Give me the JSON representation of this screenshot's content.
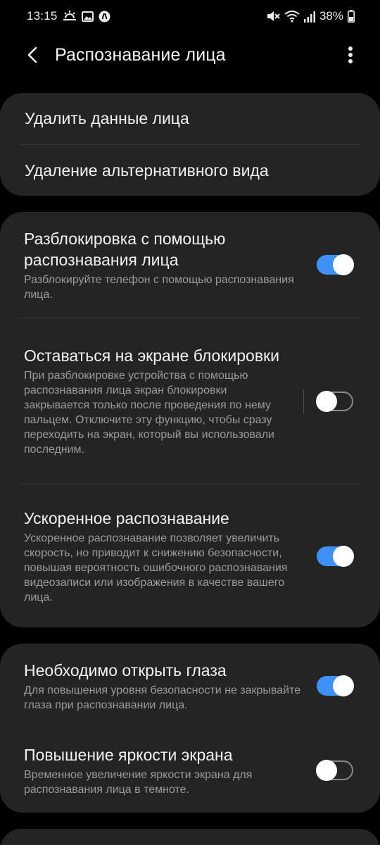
{
  "status_bar": {
    "time": "13:15",
    "left_icons": [
      "weather-icon",
      "image-icon",
      "app-notification-icon"
    ],
    "right_icons": [
      "mute-icon",
      "wifi-icon",
      "signal-icon",
      "battery-icon"
    ],
    "battery": "38%"
  },
  "app_bar": {
    "title": "Распознавание лица"
  },
  "card1": {
    "items": [
      {
        "label": "Удалить данные лица"
      },
      {
        "label": "Удаление альтернативного вида"
      }
    ]
  },
  "card2": {
    "items": [
      {
        "title": "Разблокировка с помощью распознавания лица",
        "subtitle": "Разблокируйте телефон с помощью распознавания лица.",
        "enabled": true
      },
      {
        "title": "Оставаться на экране блокировки",
        "subtitle": "При разблокировке устройства с помощью распознавания лица экран блокировки закрывается только после проведения по нему пальцем. Отключите эту функцию, чтобы сразу переходить на экран, который вы использовали последним.",
        "enabled": false
      },
      {
        "title": "Ускоренное распознавание",
        "subtitle": "Ускоренное распознавание позволяет увеличить скорость, но приводит к снижению безопасности, повышая вероятность ошибочного распознавания видеозаписи или изображения в качестве вашего лица.",
        "enabled": true
      }
    ]
  },
  "card3": {
    "items": [
      {
        "title": "Необходимо открыть глаза",
        "subtitle": "Для повышения уровня безопасности не закрывайте глаза при распознавании лица.",
        "enabled": true
      },
      {
        "title": "Повышение яркости экрана",
        "subtitle": "Временное увеличение яркости экрана для распознавания лица в темноте.",
        "enabled": false
      }
    ]
  },
  "colors": {
    "background": "#000000",
    "card": "#242424",
    "accent": "#3e91f7",
    "subtitle": "#9b9b9b"
  }
}
